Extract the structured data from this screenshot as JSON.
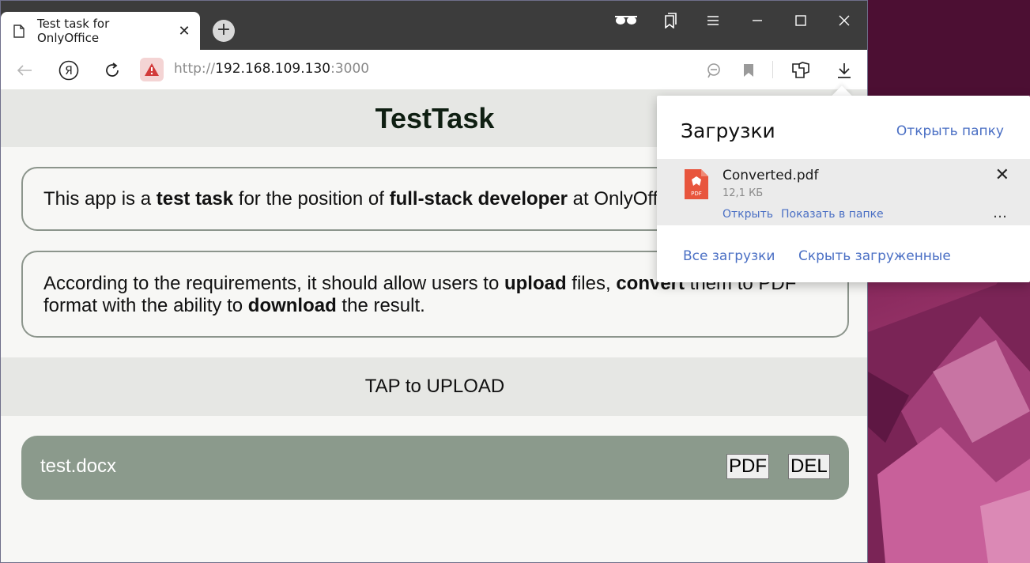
{
  "browser": {
    "tab_title": "Test task for OnlyOffice",
    "tab_close": "✕",
    "new_tab": "+",
    "url_scheme": "http://",
    "url_host": "192.168.109.130",
    "url_port": ":3000"
  },
  "page": {
    "title": "TestTask",
    "intro": {
      "p1": "This app is a ",
      "b1": "test task",
      "p2": " for the position of ",
      "b2": "full-stack developer",
      "p3": " at OnlyOffice."
    },
    "requirements": {
      "p1": "According to the requirements, it should allow users to ",
      "b1": "upload",
      "p2": " files, ",
      "b2": "convert",
      "p3": " them to PDF",
      "p4": "format with the ability to ",
      "b3": "download",
      "p5": " the result."
    },
    "upload_label": "TAP to UPLOAD",
    "files": [
      {
        "name": "test.docx",
        "pdf_label": "PDF",
        "del_label": "DEL"
      }
    ]
  },
  "downloads": {
    "title": "Загрузки",
    "open_folder": "Открыть папку",
    "item": {
      "name": "Converted.pdf",
      "size": "12,1 КБ",
      "open": "Открыть",
      "show_in_folder": "Показать в папке",
      "close": "✕",
      "more": "…"
    },
    "all_downloads": "Все загрузки",
    "hide_downloaded": "Скрыть загруженные"
  },
  "colors": {
    "accent_link": "#4a6fc4",
    "file_row": "#8b9a8c",
    "titlebar": "#3c3c3c"
  }
}
